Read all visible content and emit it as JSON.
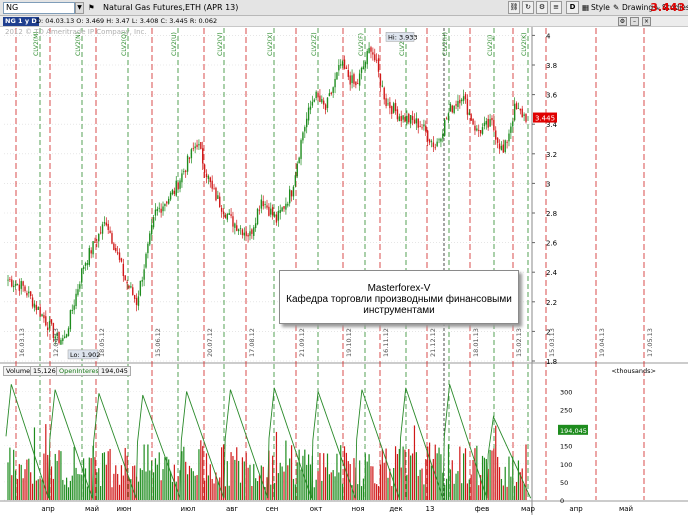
{
  "toolbar": {
    "symbol": "NG",
    "title": "Natural Gas Futures,ETH (APR 13)",
    "d_label": "D",
    "style_label": "Style",
    "drawings_label": "Drawings",
    "studies_label": "Studies",
    "last_price": "3.443"
  },
  "infobar": {
    "timeframe": "NG 1 y D",
    "ohlc": "D: 04.03.13   O: 3.469   H: 3.47   L: 3.408   C: 3.445   R: 0.062"
  },
  "watermark": "2012 © TD Ameritrade IP Company, Inc.",
  "price_axis": {
    "ticks": [
      "4",
      "3.8",
      "3.6",
      "3.4",
      "3.2",
      "3",
      "2.8",
      "2.6",
      "2.4",
      "2.2",
      "2",
      "1.8"
    ],
    "current": "3.445"
  },
  "annotations": {
    "high": "Hi: 3.933",
    "low": "Lo: 1.902"
  },
  "date_markers": [
    "16.03.13",
    "12.04.13",
    "18.05.12",
    "15.06.12",
    "20.07.12",
    "17.08.12",
    "21.09.12",
    "19.10.12",
    "16.11.12",
    "21.12.12",
    "18.01.13",
    "15.02.13",
    "15.03.13",
    "19.04.13",
    "17.05.13"
  ],
  "expiry_labels": [
    "CLV2(M)",
    "CLV2(N)",
    "CLV2(Q)",
    "CLV2(U)",
    "CLV2(V)",
    "CLV2(X)",
    "CLV2(Z)",
    "CLV2(F)",
    "CLV2(G)",
    "CLV2(H)",
    "CLV2(J)",
    "CLV2(K)"
  ],
  "info_box": {
    "line1": "Masterforex-V",
    "line2": "Кафедра торговли производными финансовыми",
    "line3": "инструментами"
  },
  "volume_panel": {
    "volume_label": "Volume",
    "volume_value": "15,126",
    "oi_label": "OpenInterest",
    "oi_value": "194,045",
    "units": "<thousands>",
    "ticks": [
      "300",
      "250",
      "200",
      "150",
      "100",
      "50",
      "0"
    ],
    "current": "194,045"
  },
  "months": [
    "апр",
    "май",
    "июн",
    "июл",
    "авг",
    "сен",
    "окт",
    "ноя",
    "дек",
    "13",
    "фев",
    "мар",
    "апр",
    "май"
  ],
  "chart_data": {
    "type": "candlestick",
    "title": "Natural Gas Futures,ETH (APR 13)",
    "ylim": [
      1.8,
      4.05
    ],
    "high": 3.933,
    "low": 1.902,
    "last": 3.445,
    "anchors": [
      [
        0,
        2.35
      ],
      [
        8,
        2.3
      ],
      [
        16,
        2.15
      ],
      [
        26,
        1.95
      ],
      [
        30,
        1.95
      ],
      [
        40,
        2.45
      ],
      [
        52,
        2.75
      ],
      [
        62,
        2.35
      ],
      [
        68,
        2.2
      ],
      [
        78,
        2.8
      ],
      [
        88,
        2.95
      ],
      [
        100,
        3.28
      ],
      [
        108,
        2.95
      ],
      [
        118,
        2.75
      ],
      [
        128,
        2.65
      ],
      [
        134,
        2.9
      ],
      [
        142,
        2.75
      ],
      [
        150,
        2.95
      ],
      [
        156,
        3.35
      ],
      [
        162,
        3.6
      ],
      [
        168,
        3.5
      ],
      [
        176,
        3.8
      ],
      [
        184,
        3.65
      ],
      [
        192,
        3.93
      ],
      [
        200,
        3.55
      ],
      [
        208,
        3.45
      ],
      [
        218,
        3.4
      ],
      [
        226,
        3.25
      ],
      [
        234,
        3.5
      ],
      [
        240,
        3.6
      ],
      [
        248,
        3.35
      ],
      [
        256,
        3.4
      ],
      [
        262,
        3.2
      ],
      [
        268,
        3.5
      ],
      [
        274,
        3.45
      ]
    ],
    "open_interest_ylim": [
      0,
      340
    ],
    "open_interest_peaks": [
      320,
      305,
      295,
      290,
      300,
      305,
      310,
      300,
      305,
      310,
      320,
      230
    ],
    "volume_ylim": [
      0,
      340
    ]
  }
}
